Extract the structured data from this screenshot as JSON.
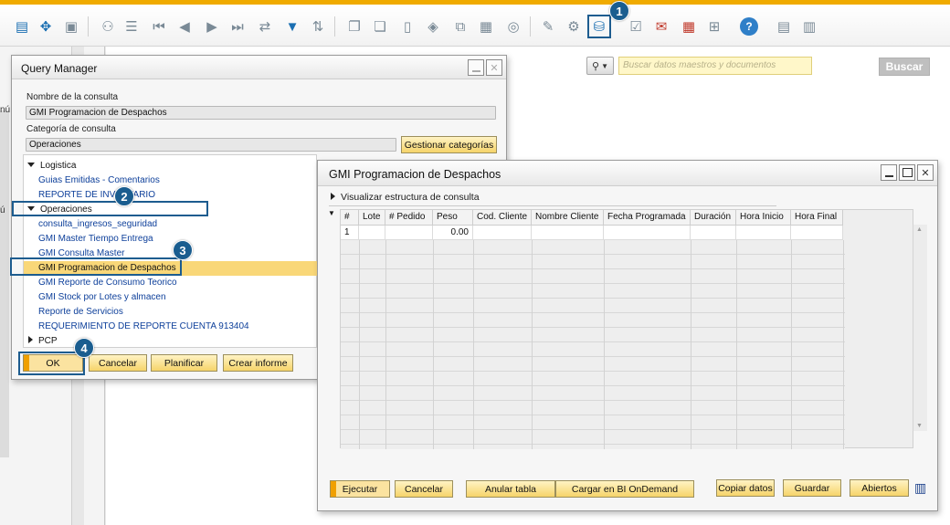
{
  "toolbar": {
    "icons": [
      "new-document-icon",
      "arrows-move-icon",
      "form-lock-icon",
      "binoculars-icon",
      "document-list-icon",
      "first-record-icon",
      "previous-record-icon",
      "next-record-icon",
      "last-record-icon",
      "refresh-icon",
      "filter-icon",
      "sort-icon",
      "copy-doc-icon",
      "copy-doc2-icon",
      "doc-icon",
      "gift-icon",
      "doc-exchange-icon",
      "doc-list-icon",
      "doc-search-icon",
      "pen-icon",
      "doc-gear-icon",
      "query-icon",
      "checklist-icon",
      "mail-icon",
      "calendar-icon",
      "hierarchy-icon",
      "help-icon",
      "report-icon",
      "report2-icon"
    ]
  },
  "left_partial": {
    "text1": "nú",
    "text2": "ú"
  },
  "search": {
    "placeholder": "Buscar datos maestros y documentos",
    "button_label": "Buscar"
  },
  "query_manager": {
    "title": "Query Manager",
    "name_label": "Nombre de la consulta",
    "name_value": "GMI Programacion de Despachos",
    "category_label": "Categoría de consulta",
    "category_value": "Operaciones",
    "manage_categories_button": "Gestionar categorías",
    "tree": [
      {
        "label": "Logistica",
        "type": "group-open"
      },
      {
        "label": "Guias Emitidas - Comentarios",
        "type": "item"
      },
      {
        "label": "REPORTE DE INVENTARIO",
        "type": "item"
      },
      {
        "label": "Operaciones",
        "type": "group-open"
      },
      {
        "label": "consulta_ingresos_seguridad",
        "type": "item"
      },
      {
        "label": "GMI  Master Tiempo Entrega",
        "type": "item"
      },
      {
        "label": "GMI Consulta Master",
        "type": "item"
      },
      {
        "label": "GMI Programacion de Despachos",
        "type": "selected"
      },
      {
        "label": "GMI Reporte de Consumo Teorico",
        "type": "item"
      },
      {
        "label": "GMI Stock por Lotes y almacen",
        "type": "item"
      },
      {
        "label": "Reporte de Servicios",
        "type": "item"
      },
      {
        "label": "REQUERIMIENTO DE REPORTE CUENTA 913404",
        "type": "item"
      },
      {
        "label": "PCP",
        "type": "group-closed"
      }
    ],
    "buttons": {
      "ok": "OK",
      "cancel": "Cancelar",
      "plan": "Planificar",
      "create_report": "Crear informe"
    }
  },
  "result_window": {
    "title": "GMI Programacion de Despachos",
    "visualize_label": "Visualizar estructura de consulta",
    "columns": [
      "#",
      "Lote",
      "# Pedido",
      "Peso",
      "Cod. Cliente",
      "Nombre Cliente",
      "Fecha Programada",
      "Duración",
      "Hora Inicio",
      "Hora Final"
    ],
    "row1": [
      "1",
      "",
      "",
      "0.00",
      "",
      "",
      "",
      "",
      "",
      ""
    ],
    "buttons": {
      "execute": "Ejecutar",
      "cancel": "Cancelar",
      "cancel_table": "Anular tabla",
      "load_bi": "Cargar en BI OnDemand",
      "copy_data": "Copiar datos",
      "save": "Guardar",
      "open": "Abiertos"
    }
  },
  "badges": [
    "1",
    "2",
    "3",
    "4"
  ],
  "colors": {
    "accent": "#f0ab00",
    "badge": "#1a5d8f",
    "selected_row": "#f9d778",
    "button": "#f6d46a",
    "link": "#0d3f9a"
  }
}
